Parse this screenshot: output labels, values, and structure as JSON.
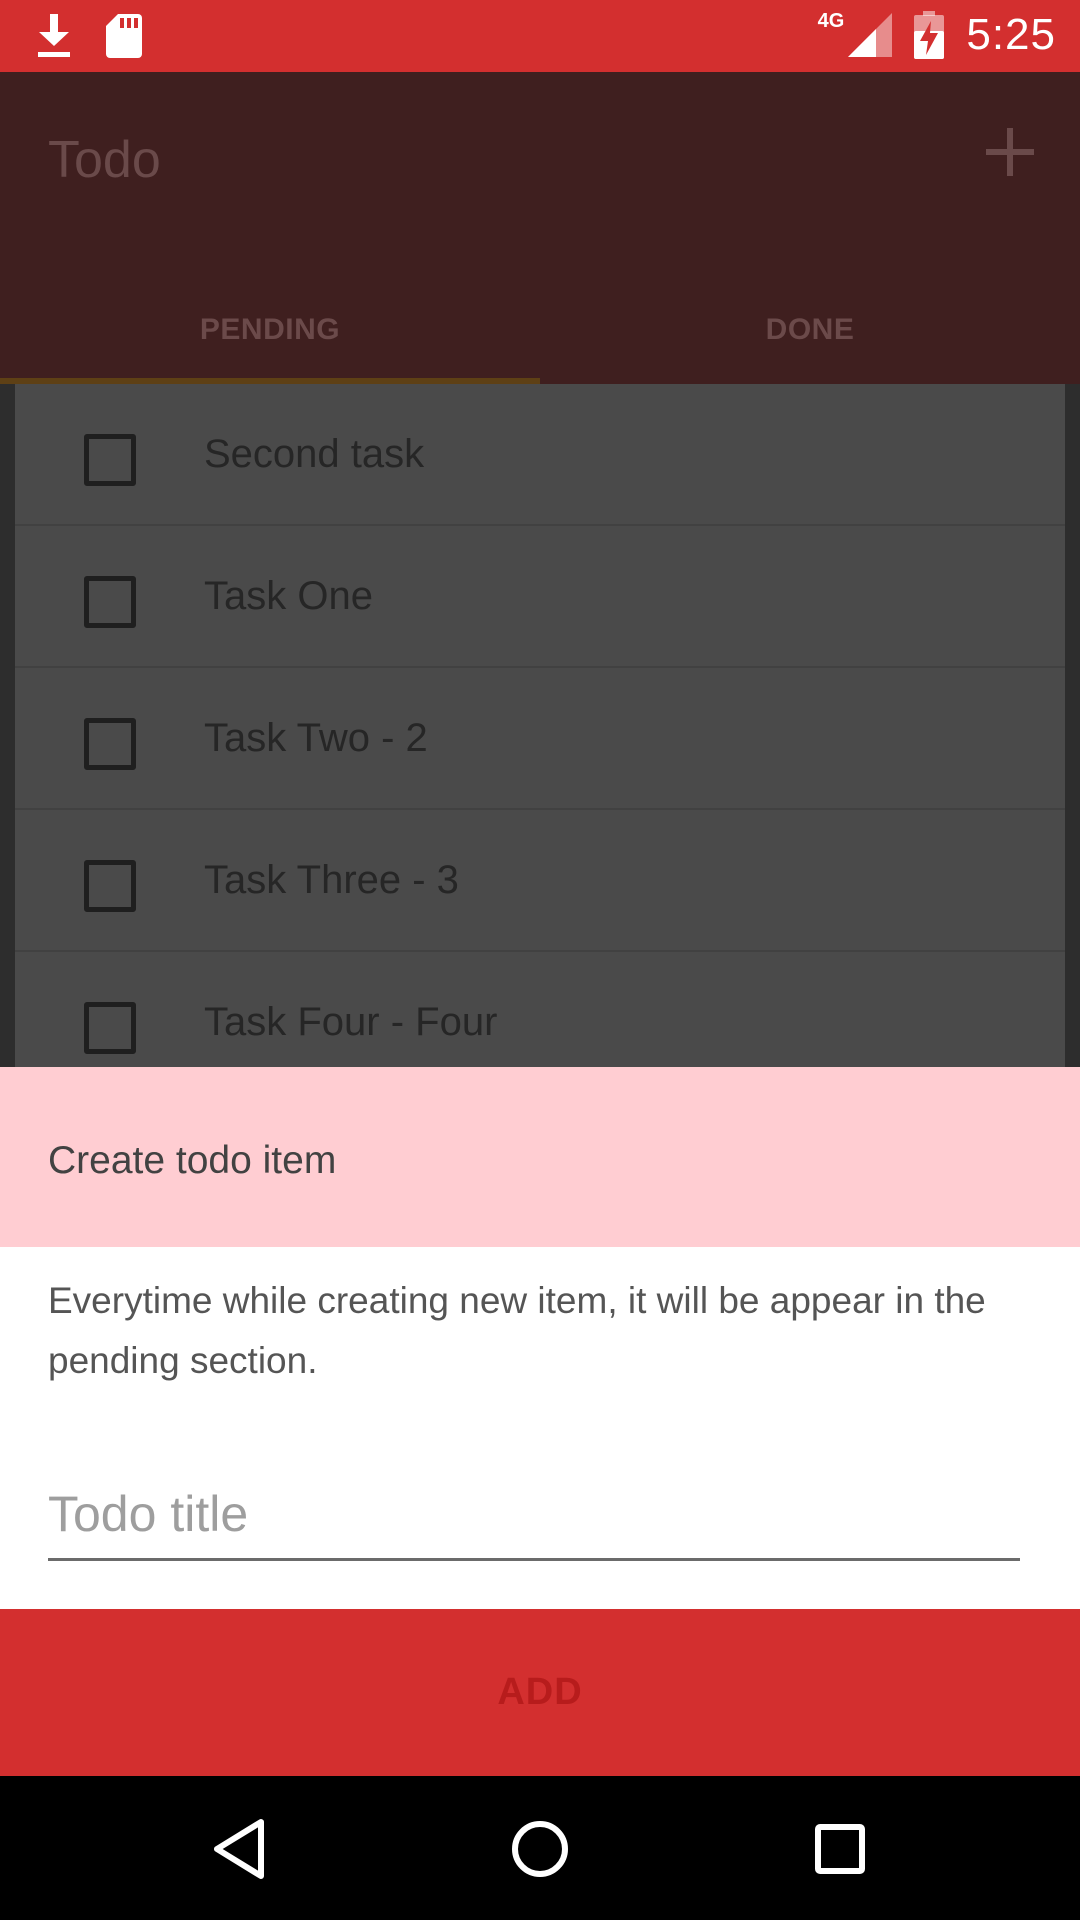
{
  "status_bar": {
    "network": "4G",
    "time": "5:25",
    "icons": [
      "download-icon",
      "sd-card-icon",
      "signal-icon",
      "battery-charging-icon"
    ]
  },
  "app_bar": {
    "title": "Todo",
    "add_icon": "plus-icon"
  },
  "tabs": [
    {
      "label": "PENDING",
      "selected": true
    },
    {
      "label": "DONE",
      "selected": false
    }
  ],
  "tasks": [
    {
      "label": "Second task",
      "checked": false
    },
    {
      "label": "Task One",
      "checked": false
    },
    {
      "label": "Task Two - 2",
      "checked": false
    },
    {
      "label": "Task Three - 3",
      "checked": false
    },
    {
      "label": "Task Four - Four",
      "checked": false
    }
  ],
  "dialog": {
    "title": "Create todo item",
    "description": "Everytime while creating new item, it will be appear in the pending section.",
    "input_value": "",
    "input_placeholder": "Todo title",
    "button_label": "ADD"
  },
  "nav_bar": {
    "icons": [
      "back-icon",
      "home-icon",
      "recents-icon"
    ]
  },
  "colors": {
    "primary": "#d32f2f",
    "dialog_header": "#ffcdd2"
  }
}
